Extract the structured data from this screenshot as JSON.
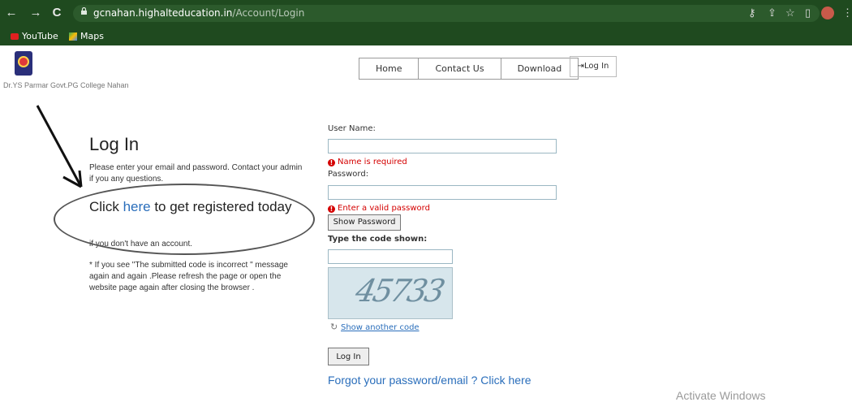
{
  "browser": {
    "url_host": "gcnahan.highaltеducation.in",
    "url_path": "/Account/Login",
    "bookmarks": [
      {
        "label": "YouTube",
        "icon": "youtube-icon"
      },
      {
        "label": "Maps",
        "icon": "maps-icon"
      }
    ]
  },
  "site": {
    "college_name": "Dr.YS Parmar Govt.PG College Nahan",
    "menu": [
      "Home",
      "Contact Us",
      "Download"
    ],
    "login_button": "Log In"
  },
  "left": {
    "heading": "Log In",
    "intro": "Please enter your email and password. Contact your admin if you any questions.",
    "click_prefix": "Click ",
    "click_link": "here",
    "click_suffix": " to get registered today",
    "no_account": "if you don't have an account.",
    "note": "* If you see \"The submitted code is incorrect \" message again and again .Please refresh the page or open the website page again after closing the browser ."
  },
  "form": {
    "username_label": "User Name:",
    "username_value": "",
    "username_error": "Name is required",
    "password_label": "Password:",
    "password_value": "",
    "password_error": "Enter a valid password",
    "show_password_label": "Show Password",
    "code_label": "Type the code shown:",
    "code_value": "",
    "captcha_text": "45733",
    "show_another_code": "Show another code",
    "submit_label": "Log In",
    "forgot_link": "Forgot your password/email ? Click here"
  },
  "overlay": {
    "watermark": "Activate Windows"
  },
  "colors": {
    "chrome_bg": "#1f4a1f",
    "link": "#2a6ebb",
    "error": "#d40000"
  }
}
